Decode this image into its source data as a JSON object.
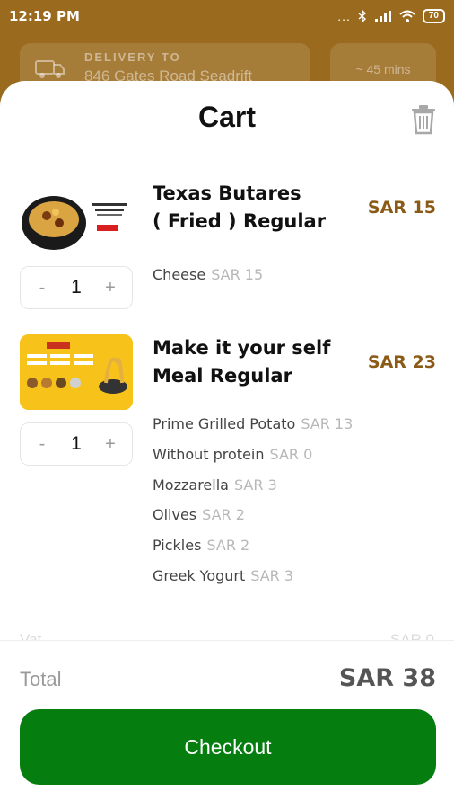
{
  "status_bar": {
    "time": "12:19 PM",
    "dots": "...",
    "battery": "70"
  },
  "header": {
    "delivery_label": "DELIVERY TO",
    "delivery_address": "846 Gates Road Seadrift",
    "eta": "~ 45 mins"
  },
  "cart": {
    "title": "Cart",
    "items": [
      {
        "name_line1": "Texas Butares",
        "name_line2": "( Fried ) Regular",
        "price": "SAR 15",
        "quantity": "1",
        "options": [
          {
            "name": "Cheese",
            "price": "SAR 15"
          }
        ]
      },
      {
        "name_line1": "Make it your self",
        "name_line2": "Meal Regular",
        "price": "SAR 23",
        "quantity": "1",
        "options": [
          {
            "name": "Prime Grilled Potato",
            "price": "SAR 13"
          },
          {
            "name": "Without protein",
            "price": "SAR 0"
          },
          {
            "name": "Mozzarella",
            "price": "SAR 3"
          },
          {
            "name": "Olives",
            "price": "SAR 2"
          },
          {
            "name": "Pickles",
            "price": "SAR 2"
          },
          {
            "name": "Greek Yogurt",
            "price": "SAR 3"
          }
        ]
      }
    ],
    "stepper": {
      "minus": "-",
      "plus": "+"
    },
    "vat_label": "Vat",
    "vat_value": "SAR 0",
    "total_label": "Total",
    "total_value": "SAR 38",
    "checkout_label": "Checkout"
  },
  "colors": {
    "brand": "#9a6a1e",
    "price": "#8a5a16",
    "checkout": "#057d0f"
  }
}
